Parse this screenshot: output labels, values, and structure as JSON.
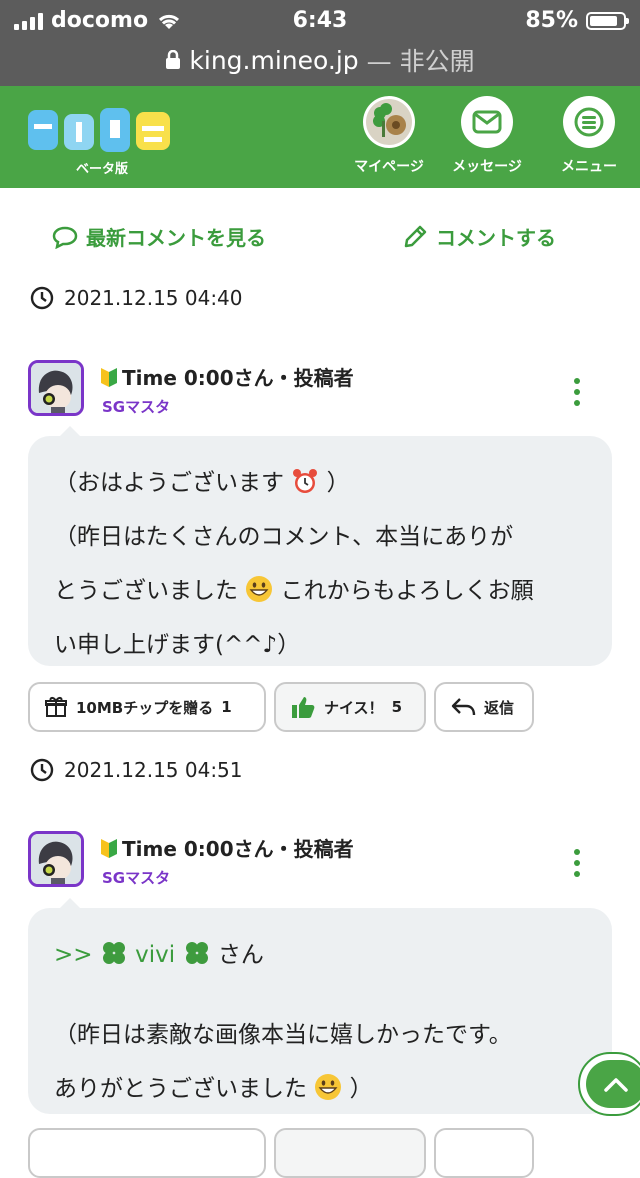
{
  "status_bar": {
    "carrier": "docomo",
    "time": "6:43",
    "battery_text": "85%",
    "battery_level": 0.85
  },
  "url_bar": {
    "domain": "king.mineo.jp",
    "suffix": "— 非公開"
  },
  "header": {
    "logo_text": "マイネ王",
    "logo_sub": "ベータ版",
    "nav": [
      {
        "label": "マイページ",
        "icon": "avatar"
      },
      {
        "label": "メッセージ",
        "icon": "mail-icon"
      },
      {
        "label": "メニュー",
        "icon": "hamburger-icon"
      }
    ]
  },
  "actions": {
    "latest_label": "最新コメントを見る",
    "comment_label": "コメントする"
  },
  "comments": [
    {
      "timestamp": "2021.12.15 04:40",
      "poster_name": "Time 0:00さん・投稿者",
      "poster_role": "SGマスタ",
      "lines": [
        "（おはようございます",
        "（昨日はたくさんのコメント、本当にありが",
        "とうございました",
        "これからもよろしくお願",
        "い申し上げます(^^♪）"
      ],
      "buttons": {
        "gift": "10MBチップを贈る",
        "gift_count": "1",
        "like": "ナイス！",
        "like_count": "5",
        "reply": "返信"
      }
    },
    {
      "timestamp": "2021.12.15 04:51",
      "poster_name": "Time 0:00さん・投稿者",
      "poster_role": "SGマスタ",
      "reply_prefix": ">>",
      "reply_name": "vivi",
      "reply_suffix": "さん",
      "lines": [
        "（昨日は素敵な画像本当に嬉しかったです。",
        "ありがとうございました",
        "）"
      ]
    }
  ],
  "colors": {
    "brand_green": "#4aa546",
    "text_green": "#3b9c3d",
    "purple": "#7a35c8",
    "bubble_bg": "#edf0f2"
  }
}
